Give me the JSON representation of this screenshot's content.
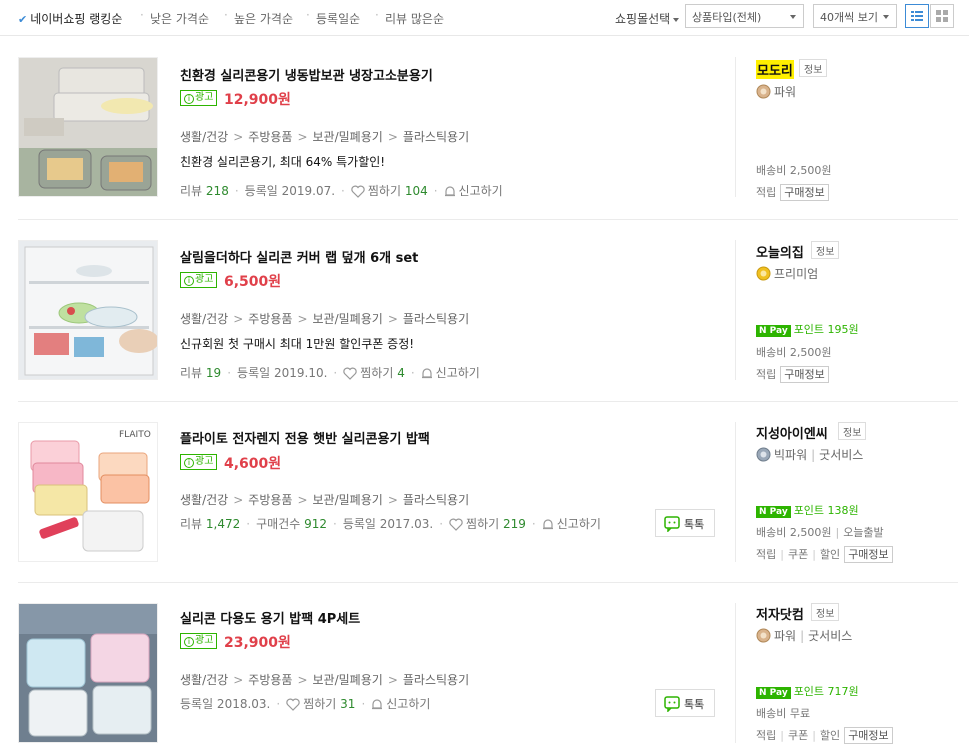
{
  "sort": {
    "items": [
      {
        "label": "네이버쇼핑 랭킹순",
        "active": true
      },
      {
        "label": "낮은 가격순",
        "active": false
      },
      {
        "label": "높은 가격순",
        "active": false
      },
      {
        "label": "등록일순",
        "active": false
      },
      {
        "label": "리뷰 많은순",
        "active": false
      }
    ]
  },
  "filters": {
    "mall_select_label": "쇼핑몰선택",
    "product_type": "상품타입(전체)",
    "page_size": "40개씩 보기",
    "view_modes": [
      "list-view-icon",
      "grid-view-icon"
    ]
  },
  "colors": {
    "price": "#e0404a",
    "accent_green": "#2db400",
    "review_number": "#2e8a2e",
    "highlight": "#fff000"
  },
  "products": [
    {
      "title": "친환경 실리콘용기 냉동밥보관 냉장고소분용기",
      "ad_label": "광고",
      "price": "12,900원",
      "categories": [
        "생활/건강",
        "주방용품",
        "보관/밀폐용기",
        "플라스틱용기"
      ],
      "description": "친환경 실리콘용기, 최대 64% 특가할인!",
      "meta": [
        {
          "label": "리뷰",
          "value": "218"
        },
        {
          "label": "등록일 2019.07.",
          "value": ""
        },
        {
          "label": "찜하기",
          "value": "104"
        },
        {
          "label": "신고하기",
          "value": ""
        }
      ],
      "talk_label": "",
      "mall": {
        "name": "모도리",
        "highlight": true,
        "info_label": "정보",
        "grade": "파워",
        "grade_extra": "",
        "medal_color": "#d9b38c"
      },
      "npay_points": "",
      "shipping": "배송비 2,500원",
      "shipping_extra": "",
      "links": [
        "적립"
      ],
      "buy_info": "구매정보"
    },
    {
      "title": "살림을더하다 실리콘 커버 랩 덮개 6개 set",
      "ad_label": "광고",
      "price": "6,500원",
      "categories": [
        "생활/건강",
        "주방용품",
        "보관/밀폐용기",
        "플라스틱용기"
      ],
      "description": "신규회원 첫 구매시 최대 1만원 할인쿠폰 증정!",
      "meta": [
        {
          "label": "리뷰",
          "value": "19"
        },
        {
          "label": "등록일 2019.10.",
          "value": ""
        },
        {
          "label": "찜하기",
          "value": "4"
        },
        {
          "label": "신고하기",
          "value": ""
        }
      ],
      "talk_label": "",
      "mall": {
        "name": "오늘의집",
        "highlight": false,
        "info_label": "정보",
        "grade": "프리미엄",
        "grade_extra": "",
        "medal_color": "#f0c020"
      },
      "npay_points": "포인트 195원",
      "shipping": "배송비 2,500원",
      "shipping_extra": "",
      "links": [
        "적립"
      ],
      "buy_info": "구매정보"
    },
    {
      "title": "플라이토 전자렌지 전용 햇반 실리콘용기 밥팩",
      "ad_label": "광고",
      "price": "4,600원",
      "categories": [
        "생활/건강",
        "주방용품",
        "보관/밀폐용기",
        "플라스틱용기"
      ],
      "description": "",
      "meta": [
        {
          "label": "리뷰",
          "value": "1,472"
        },
        {
          "label": "구매건수",
          "value": "912"
        },
        {
          "label": "등록일 2017.03.",
          "value": ""
        },
        {
          "label": "찜하기",
          "value": "219"
        },
        {
          "label": "신고하기",
          "value": ""
        }
      ],
      "talk_label": "톡톡",
      "mall": {
        "name": "지성아이엔씨",
        "highlight": false,
        "info_label": "정보",
        "grade": "빅파워",
        "grade_extra": "굿서비스",
        "medal_color": "#9aa8b8"
      },
      "npay_points": "포인트 138원",
      "shipping": "배송비 2,500원",
      "shipping_extra": "오늘출발",
      "links": [
        "적립",
        "쿠폰",
        "할인"
      ],
      "buy_info": "구매정보"
    },
    {
      "title": "실리콘 다용도 용기 밥팩 4P세트",
      "ad_label": "광고",
      "price": "23,900원",
      "categories": [
        "생활/건강",
        "주방용품",
        "보관/밀폐용기",
        "플라스틱용기"
      ],
      "description": "",
      "meta": [
        {
          "label": "등록일 2018.03.",
          "value": ""
        },
        {
          "label": "찜하기",
          "value": "31"
        },
        {
          "label": "신고하기",
          "value": ""
        }
      ],
      "talk_label": "톡톡",
      "mall": {
        "name": "저자닷컴",
        "highlight": false,
        "info_label": "정보",
        "grade": "파워",
        "grade_extra": "굿서비스",
        "medal_color": "#d9b38c"
      },
      "npay_points": "포인트 717원",
      "shipping": "배송비 무료",
      "shipping_extra": "",
      "links": [
        "적립",
        "쿠폰",
        "할인"
      ],
      "buy_info": "구매정보"
    }
  ]
}
